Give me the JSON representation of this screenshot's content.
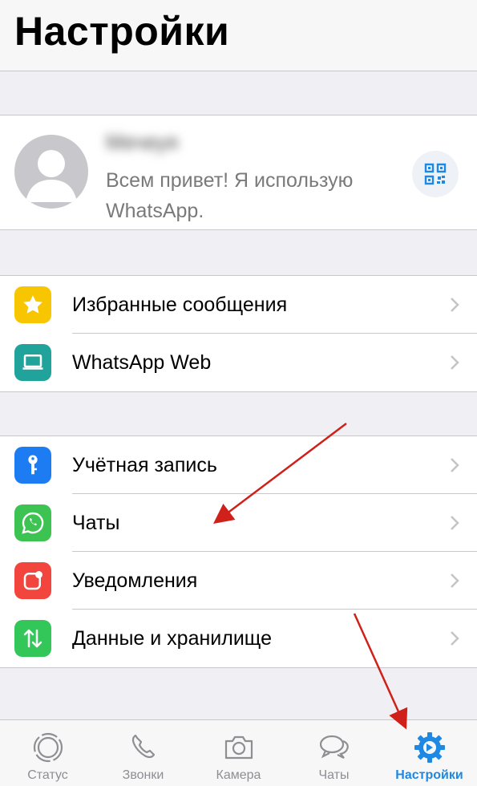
{
  "header": {
    "title": "Настройки"
  },
  "profile": {
    "name": "Мечеуя",
    "status": "Всем привет! Я использую WhatsApp."
  },
  "group1": [
    {
      "label": "Избранные сообщения",
      "icon": "star-icon",
      "color": "#f7c600"
    },
    {
      "label": "WhatsApp Web",
      "icon": "laptop-icon",
      "color": "#1fa39a"
    }
  ],
  "group2": [
    {
      "label": "Учётная запись",
      "icon": "key-icon",
      "color": "#1e7cf2"
    },
    {
      "label": "Чаты",
      "icon": "whatsapp-icon",
      "color": "#3cc351"
    },
    {
      "label": "Уведомления",
      "icon": "notification-icon",
      "color": "#f2453d"
    },
    {
      "label": "Данные и хранилище",
      "icon": "data-arrows-icon",
      "color": "#33c759"
    }
  ],
  "tabs": [
    {
      "label": "Статус",
      "icon": "status-icon",
      "active": false
    },
    {
      "label": "Звонки",
      "icon": "phone-icon",
      "active": false
    },
    {
      "label": "Камера",
      "icon": "camera-icon",
      "active": false
    },
    {
      "label": "Чаты",
      "icon": "chats-icon",
      "active": false
    },
    {
      "label": "Настройки",
      "icon": "settings-gear-icon",
      "active": true
    }
  ],
  "colors": {
    "accent": "#1e88e5",
    "annotation_arrow": "#d0201a"
  }
}
